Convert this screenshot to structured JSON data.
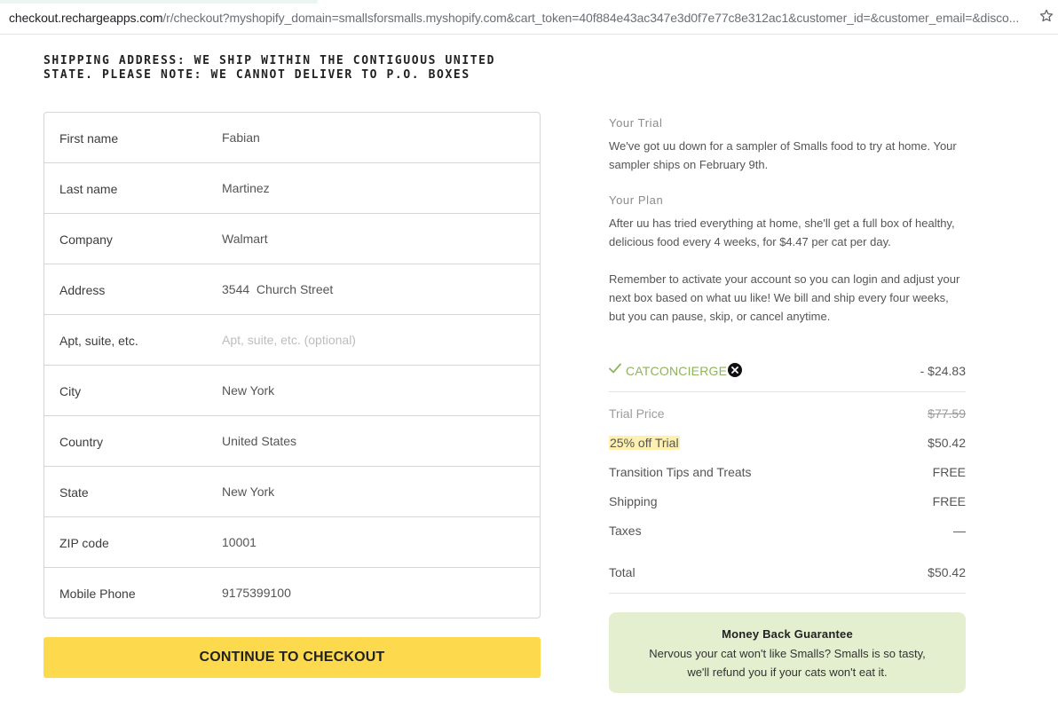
{
  "browser": {
    "url_host": "checkout.rechargeapps.com",
    "url_path": "/r/checkout?myshopify_domain=smallsforsmalls.myshopify.com&cart_token=40f884e43ac347e3d0f7e77c8e312ac1&customer_id=&customer_email=&disco...",
    "bookmark_icon": "star-icon"
  },
  "shipping": {
    "heading": "SHIPPING ADDRESS: WE SHIP WITHIN THE CONTIGUOUS UNITED STATE. PLEASE NOTE: WE CANNOT DELIVER TO P.O. BOXES"
  },
  "form": {
    "fields": [
      {
        "label": "First name",
        "value": "Fabian",
        "placeholder": ""
      },
      {
        "label": "Last name",
        "value": "Martinez",
        "placeholder": ""
      },
      {
        "label": "Company",
        "value": "Walmart",
        "placeholder": ""
      },
      {
        "label": "Address",
        "value": "3544  Church Street",
        "placeholder": ""
      },
      {
        "label": "Apt, suite, etc.",
        "value": "",
        "placeholder": "Apt, suite, etc. (optional)"
      },
      {
        "label": "City",
        "value": "New York",
        "placeholder": ""
      },
      {
        "label": "Country",
        "value": "United States",
        "placeholder": ""
      },
      {
        "label": "State",
        "value": "New York",
        "placeholder": ""
      },
      {
        "label": "ZIP code",
        "value": "10001",
        "placeholder": ""
      },
      {
        "label": "Mobile Phone",
        "value": "9175399100",
        "placeholder": ""
      }
    ],
    "submit_label": "CONTINUE TO CHECKOUT"
  },
  "summary": {
    "trial_label": "Your Trial",
    "trial_text": "We've got uu down for a sampler of Smalls food to try at home. Your sampler ships on February 9th.",
    "plan_label": "Your Plan",
    "plan_text": "After uu has tried everything at home, she'll get a full box of healthy, delicious food every 4 weeks, for $4.47 per cat per day.",
    "reminder_text": "Remember to activate your account so you can login and adjust your next box based on what uu like! We bill and ship every four weeks, but you can pause, skip, or cancel anytime.",
    "promo": {
      "code": "CATCONCIERGE",
      "amount": "- $24.83",
      "check_icon": "check-icon",
      "remove_icon": "close-circle-icon"
    },
    "lines": {
      "trial_price": {
        "label": "Trial Price",
        "value": "$77.59"
      },
      "discount": {
        "label": "25% off Trial",
        "value": "$50.42"
      },
      "tips": {
        "label": "Transition Tips and Treats",
        "value": "FREE"
      },
      "shipping": {
        "label": "Shipping",
        "value": "FREE"
      },
      "taxes": {
        "label": "Taxes",
        "value": "—"
      },
      "total": {
        "label": "Total",
        "value": "$50.42"
      }
    },
    "guarantee": {
      "title": "Money Back Guarantee",
      "body": "Nervous your cat won't like Smalls? Smalls is so tasty, we'll refund you if your cats won't eat it."
    }
  },
  "colors": {
    "accent_button": "#fdd94e",
    "promo_green": "#8fb35c",
    "guarantee_bg": "#e3efcf",
    "highlight": "#fdf0b0"
  }
}
